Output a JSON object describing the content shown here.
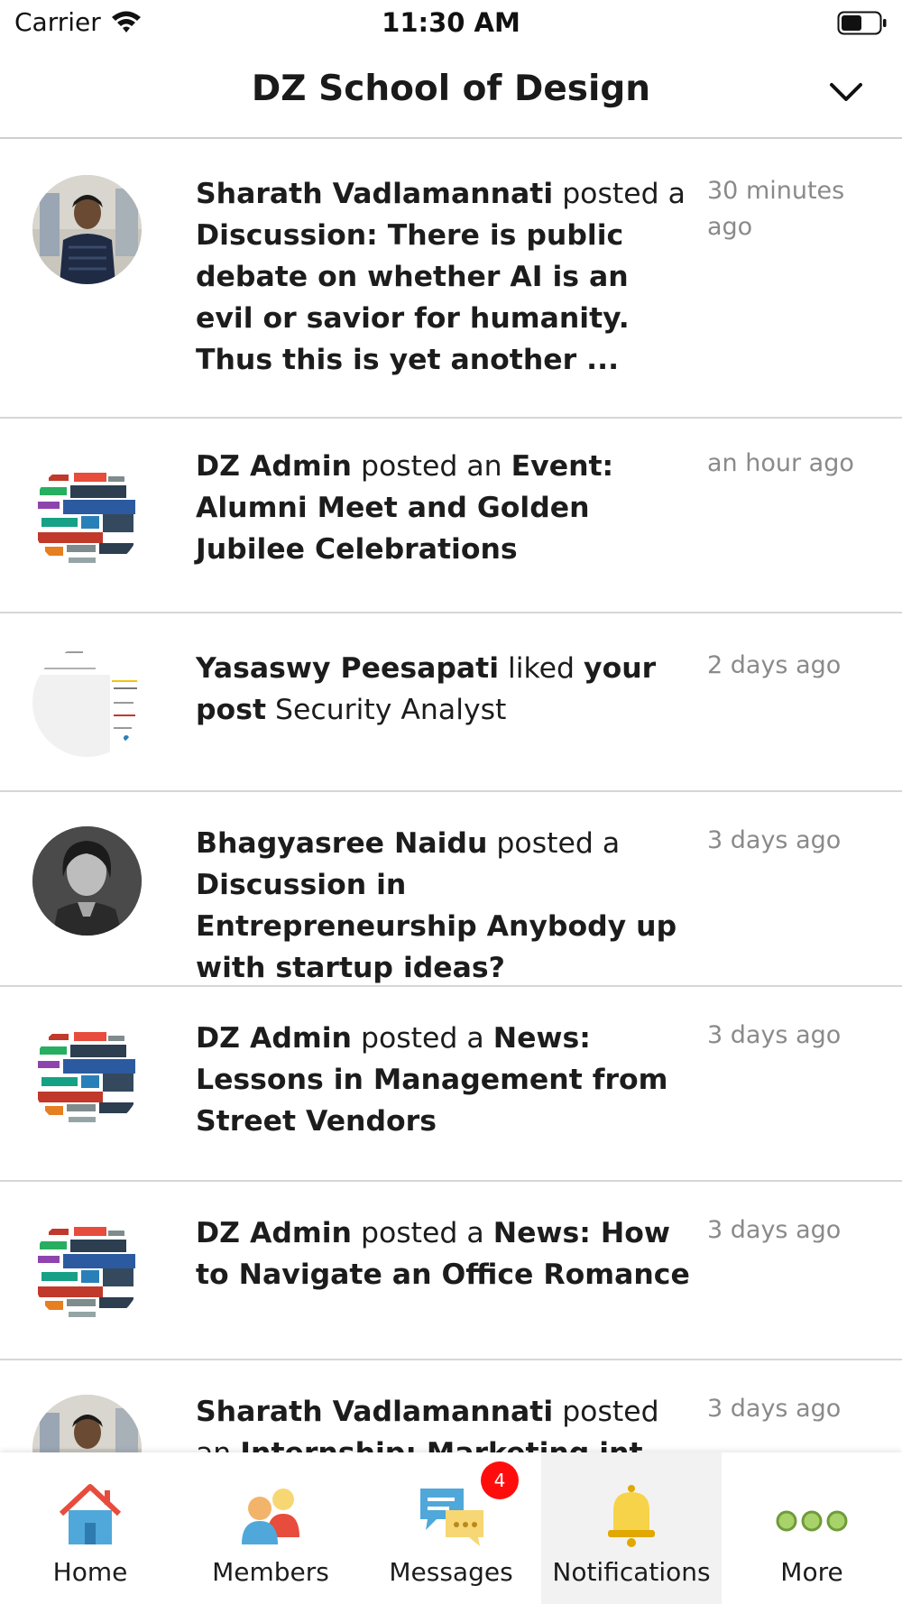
{
  "status_bar": {
    "carrier": "Carrier",
    "time": "11:30 AM"
  },
  "header": {
    "title": "DZ School of Design"
  },
  "feed": [
    {
      "actor": "Sharath Vadlamannati",
      "verb": "posted a",
      "object": "Discussion: There is public debate on whether AI is an evil or savior for humanity. Thus this is yet another ...",
      "detail": "",
      "time": "30 minutes ago",
      "avatar": "photo-man"
    },
    {
      "actor": "DZ Admin",
      "verb": "posted an",
      "object": "Event: Alumni Meet and Golden Jubilee Celebrations",
      "detail": "",
      "time": "an hour ago",
      "avatar": "word-cloud-logo"
    },
    {
      "actor": "Yasaswy Peesapati",
      "verb": "liked",
      "object": "your post",
      "detail": "Security Analyst",
      "time": "2 days ago",
      "avatar": "document-thumbnail"
    },
    {
      "actor": "Bhagyasree Naidu",
      "verb": "posted a",
      "object": "Discussion in Entrepreneurship Anybody up with startup ideas?",
      "detail": "",
      "time": "3 days ago",
      "avatar": "photo-woman"
    },
    {
      "actor": "DZ Admin",
      "verb": "posted a",
      "object": "News: Lessons in Management from Street Vendors",
      "detail": "",
      "time": "3 days ago",
      "avatar": "word-cloud-logo"
    },
    {
      "actor": "DZ Admin",
      "verb": "posted a",
      "object": "News: How to Navigate an Office Romance",
      "detail": "",
      "time": "3 days ago",
      "avatar": "word-cloud-logo"
    },
    {
      "actor": "Sharath Vadlamannati",
      "verb": "posted an",
      "object": "Internship: Marketing int...",
      "detail": "",
      "time": "3 days ago",
      "avatar": "photo-man"
    }
  ],
  "tabbar": {
    "tabs": [
      {
        "label": "Home",
        "icon": "house-icon"
      },
      {
        "label": "Members",
        "icon": "members-icon"
      },
      {
        "label": "Messages",
        "icon": "chat-bubbles-icon"
      },
      {
        "label": "Notifications",
        "icon": "bell-icon"
      },
      {
        "label": "More",
        "icon": "three-dots-icon"
      }
    ],
    "messages_badge": "4",
    "active_tab": "Notifications"
  },
  "colors": {
    "badge": "#ff0d0d",
    "divider": "#d6d6d6",
    "timestamp": "#8a8a8a",
    "active_tab_bg": "#f2f2f2"
  }
}
